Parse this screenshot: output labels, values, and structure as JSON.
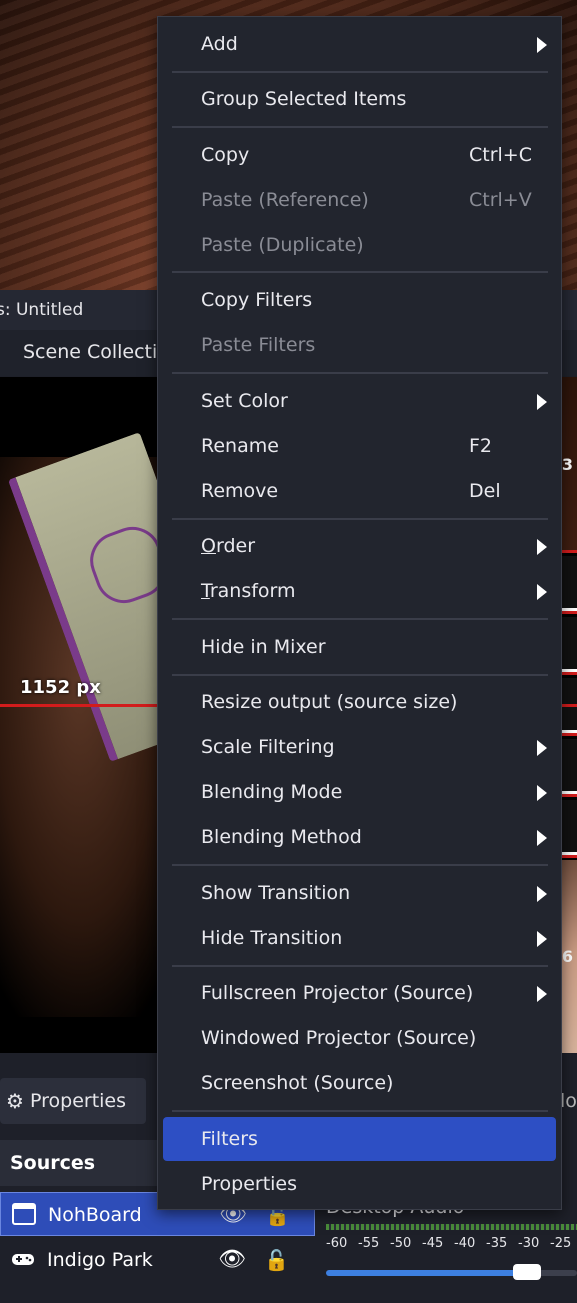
{
  "window": {
    "title_fragment": "s: Untitled"
  },
  "menubar": {
    "item": "Scene Collection"
  },
  "preview": {
    "width_label": "1152 px",
    "edge_label_top": "3",
    "edge_label_bottom": "6"
  },
  "toolbar": {
    "properties_label": "Properties",
    "right_fragment": "lo"
  },
  "sources": {
    "header": "Sources",
    "items": [
      {
        "name": "NohBoard",
        "icon": "window-capture-icon",
        "selected": true
      },
      {
        "name": "Indigo Park",
        "icon": "gamepad-icon",
        "selected": false
      }
    ]
  },
  "audio": {
    "title": "Desktop Audio",
    "ticks": [
      "-60",
      "-55",
      "-50",
      "-45",
      "-40",
      "-35",
      "-30",
      "-25"
    ],
    "volume_fraction": 0.8
  },
  "context_menu": {
    "items": [
      {
        "label": "Add",
        "submenu": true
      },
      {
        "label": "Group Selected Items"
      },
      {
        "label": "Copy",
        "shortcut": "Ctrl+C"
      },
      {
        "label": "Paste (Reference)",
        "shortcut": "Ctrl+V",
        "disabled": true
      },
      {
        "label": "Paste (Duplicate)",
        "disabled": true
      },
      {
        "label": "Copy Filters"
      },
      {
        "label": "Paste Filters",
        "disabled": true
      },
      {
        "label": "Set Color",
        "submenu": true
      },
      {
        "label": "Rename",
        "shortcut": "F2"
      },
      {
        "label": "Remove",
        "shortcut": "Del"
      },
      {
        "label": "Order",
        "submenu": true,
        "mnemonic": "O"
      },
      {
        "label": "Transform",
        "submenu": true,
        "mnemonic": "T"
      },
      {
        "label": "Hide in Mixer"
      },
      {
        "label": "Resize output (source size)"
      },
      {
        "label": "Scale Filtering",
        "submenu": true
      },
      {
        "label": "Blending Mode",
        "submenu": true
      },
      {
        "label": "Blending Method",
        "submenu": true
      },
      {
        "label": "Show Transition",
        "submenu": true
      },
      {
        "label": "Hide Transition",
        "submenu": true
      },
      {
        "label": "Fullscreen Projector (Source)",
        "submenu": true
      },
      {
        "label": "Windowed Projector (Source)"
      },
      {
        "label": "Screenshot (Source)"
      },
      {
        "label": "Filters",
        "highlighted": true
      },
      {
        "label": "Properties"
      }
    ]
  },
  "colors": {
    "menu_bg": "#22252e",
    "highlight": "#2d4fc4",
    "selection": "#2e4db8",
    "red_guide": "#d21c1c"
  }
}
